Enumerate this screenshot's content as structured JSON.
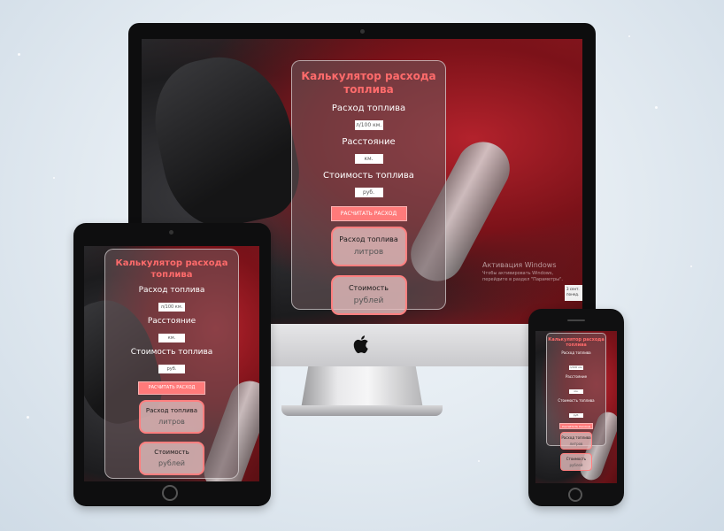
{
  "app": {
    "title": "Калькулятор расхода топлива",
    "consumption_label": "Расход топлива",
    "consumption_placeholder": "л/100 км.",
    "distance_label": "Расстояние",
    "distance_placeholder": "км.",
    "fuel_price_label": "Стоимость топлива",
    "fuel_price_placeholder": "руб.",
    "calculate_button": "РАСЧИТАТЬ РАСХОД",
    "result_fuel_title": "Расход топлива",
    "result_fuel_unit": "литров",
    "result_cost_title": "Стоимость",
    "result_cost_unit": "рублей"
  },
  "windows_watermark": {
    "title": "Активация Windows",
    "text": "Чтобы активировать Windows, перейдите в раздел \"Параметры\"."
  },
  "taskbar_chip": "3 сент. понед.",
  "colors": {
    "accent": "#ff6b6b",
    "button": "#ff7a7a",
    "card_overlay": "rgba(110,90,92,0.55)",
    "background": "#e6edf3"
  },
  "icons": {
    "imac_logo": "apple-logo-icon",
    "ipad_home": "home-button-icon",
    "iphone_home": "home-button-icon"
  }
}
